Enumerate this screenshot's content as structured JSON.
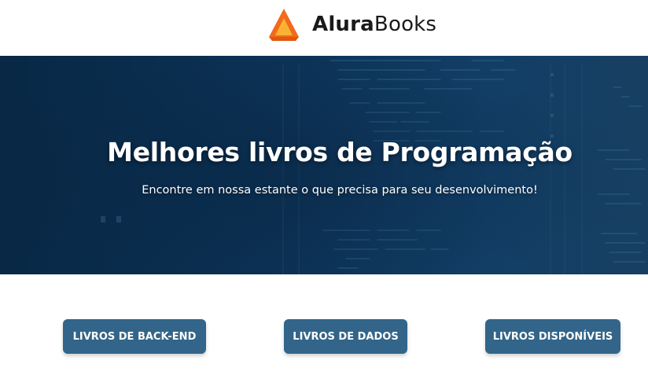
{
  "header": {
    "brand": {
      "name_bold": "Alura",
      "name_light": "Books",
      "logo_icon": "alurabooks-logo-icon",
      "colors": {
        "logo_orange": "#f26a1b",
        "logo_yellow": "#f9b233"
      }
    }
  },
  "hero": {
    "title": "Melhores livros de Programação",
    "subtitle": "Encontre em nossa estante o que precisa para seu desenvolvimento!",
    "background_color": "#0c3256"
  },
  "categories": {
    "backend_label": "LIVROS DE BACK-END",
    "dados_label": "LIVROS DE DADOS",
    "disponiveis_label": "LIVROS DISPONÍVEIS",
    "button_color": "#326589"
  }
}
